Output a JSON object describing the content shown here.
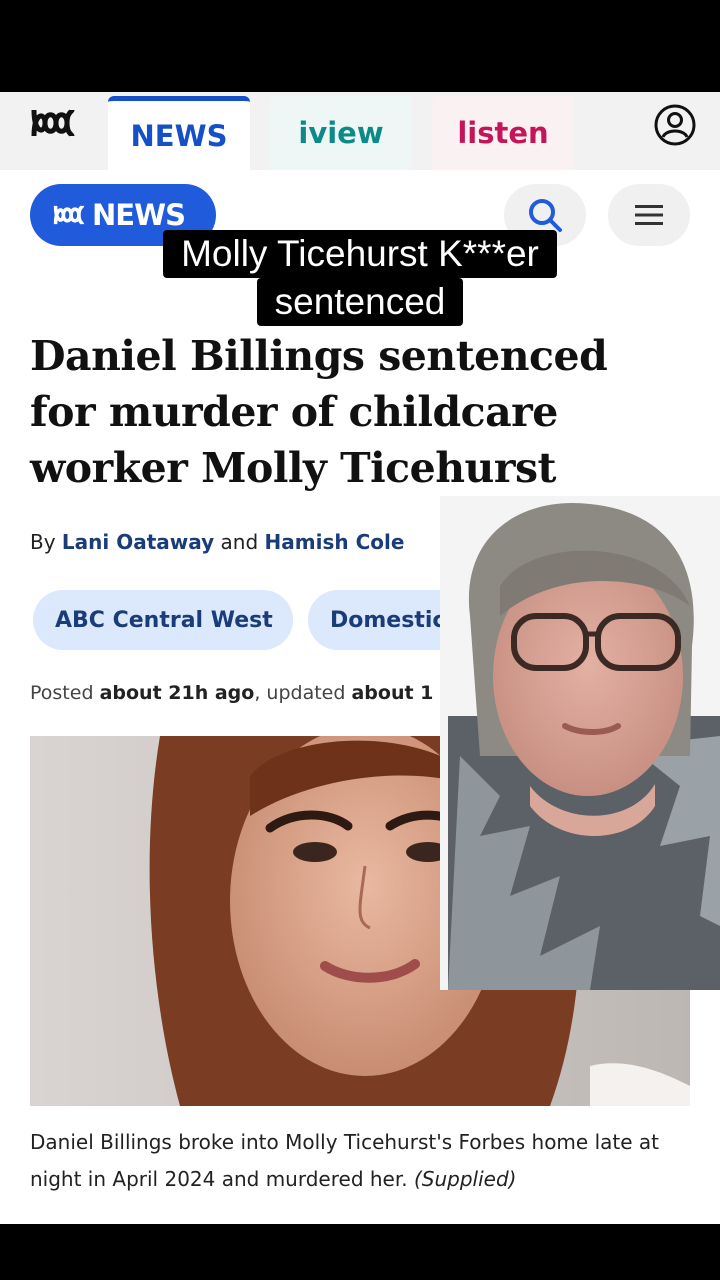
{
  "nav": {
    "tabs": [
      {
        "label": "NEWS",
        "active": true,
        "color": "#1550c8"
      },
      {
        "label": "iview",
        "active": false,
        "color": "#0c8a8a"
      },
      {
        "label": "listen",
        "active": false,
        "color": "#c4145a"
      }
    ],
    "logo_icon": "abc-logo-icon",
    "account_icon": "account-icon"
  },
  "brand": {
    "label": "NEWS",
    "search_icon": "search-icon",
    "menu_icon": "hamburger-menu-icon"
  },
  "overlay_caption": {
    "line1": "Molly Ticehurst K***er",
    "line2": "sentenced"
  },
  "article": {
    "headline": "Daniel Billings sentenced for murder of childcare worker Molly Ticehurst",
    "byline_prefix": "By",
    "author1": "Lani Oataway",
    "byline_and": "and",
    "author2": "Hamish Cole",
    "tags": [
      "ABC Central West",
      "Domestic Violence"
    ],
    "posted_label": "Posted",
    "posted_value": "about 21h ago",
    "updated_label": ", updated",
    "updated_value": "about 1",
    "photo_caption": "Daniel Billings broke into Molly Ticehurst's Forbes home late at night in April 2024 and murdered her.",
    "photo_credit": "(Supplied)"
  },
  "colors": {
    "brand_blue": "#1f5bdb",
    "tag_bg": "#dce8fb",
    "link_navy": "#1a3d7a"
  }
}
